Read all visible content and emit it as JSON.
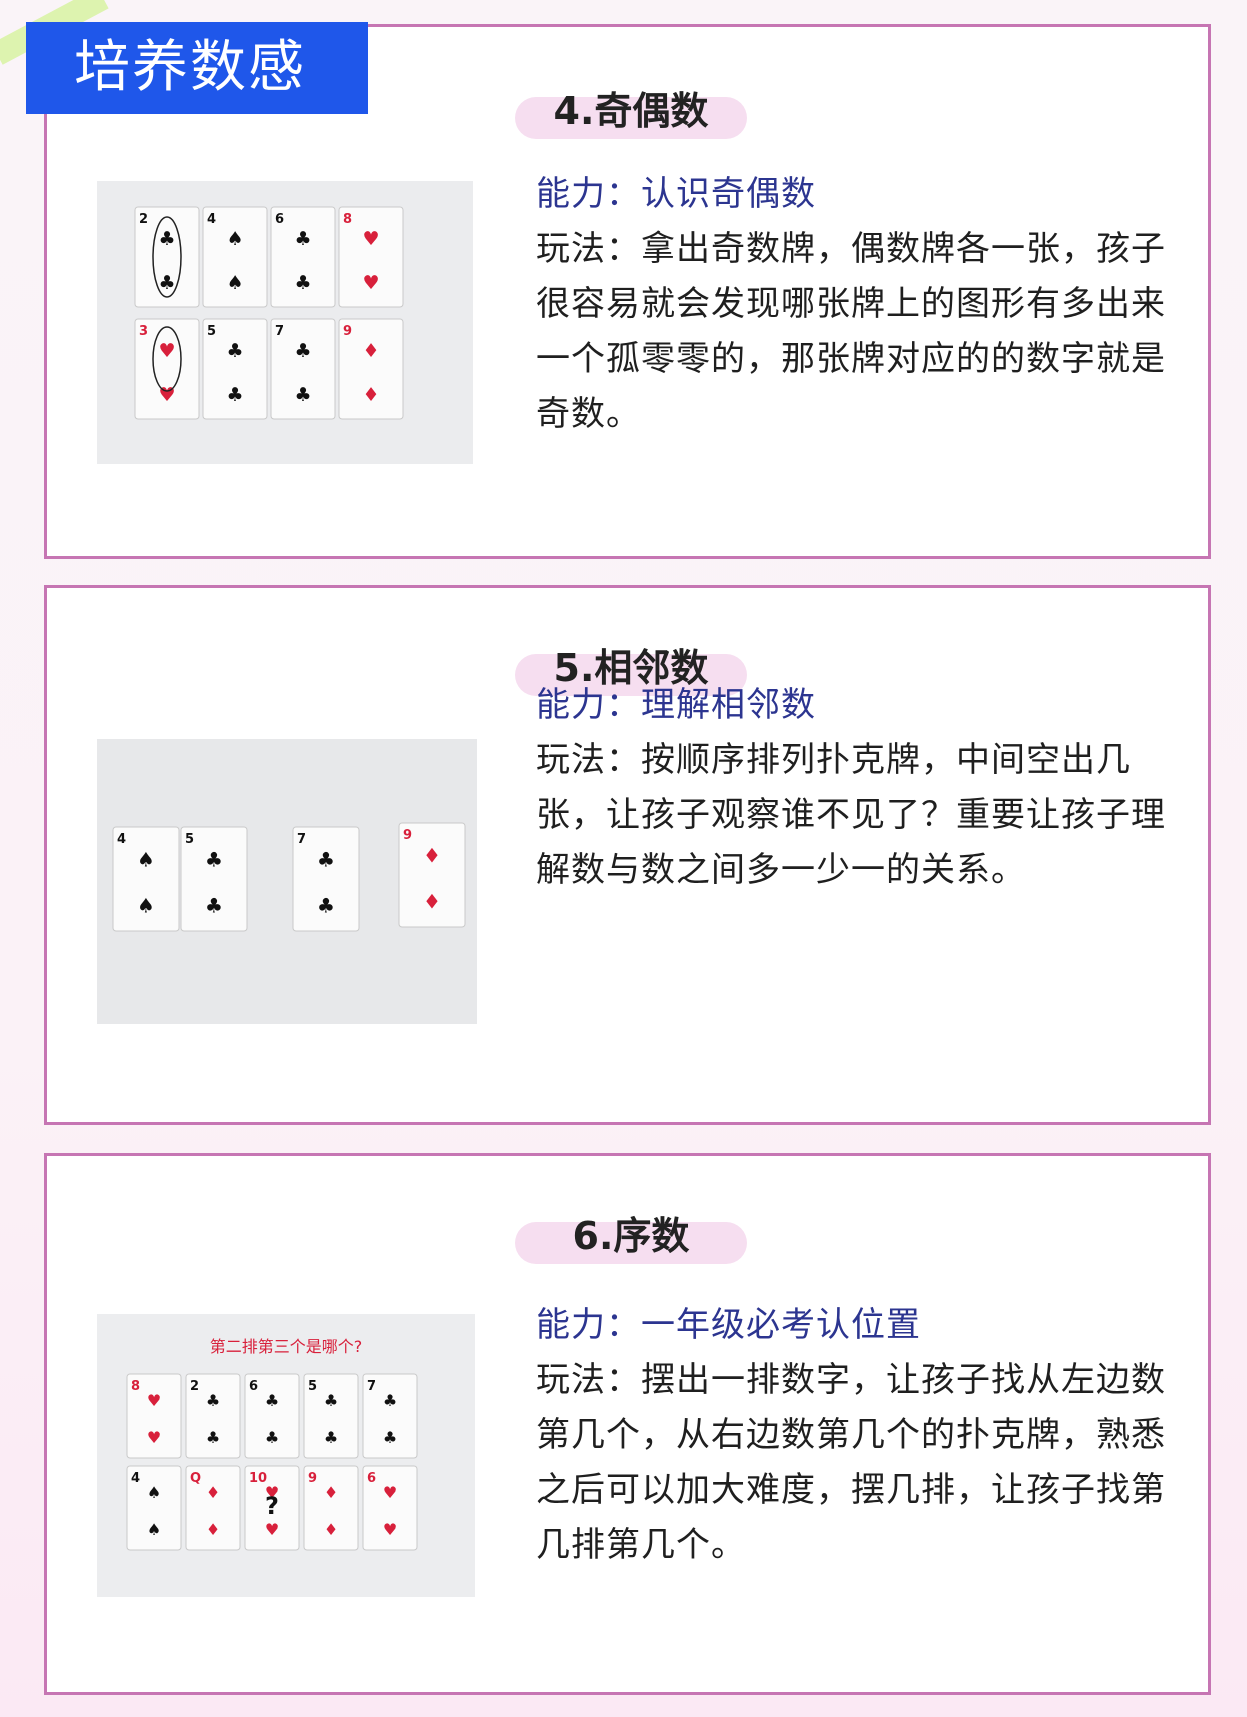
{
  "header": {
    "title": "培养数感"
  },
  "sections": [
    {
      "title": "4.奇偶数",
      "ability": "能力：认识奇偶数",
      "method": "玩法：拿出奇数牌，偶数牌各一张，孩子很容易就会发现哪张牌上的图形有多出来一个孤零零的，那张牌对应的的数字就是奇数。",
      "photo": {
        "rows": [
          [
            {
              "rank": "2",
              "suit": "♣",
              "color": "#111"
            },
            {
              "rank": "4",
              "suit": "♠",
              "color": "#111"
            },
            {
              "rank": "6",
              "suit": "♣",
              "color": "#111"
            },
            {
              "rank": "8",
              "suit": "♥",
              "color": "#d8203b"
            }
          ],
          [
            {
              "rank": "3",
              "suit": "♥",
              "color": "#d8203b"
            },
            {
              "rank": "5",
              "suit": "♣",
              "color": "#111"
            },
            {
              "rank": "7",
              "suit": "♣",
              "color": "#111"
            },
            {
              "rank": "9",
              "suit": "♦",
              "color": "#d8203b"
            }
          ]
        ]
      }
    },
    {
      "title": "5.相邻数",
      "ability": "能力：理解相邻数",
      "method": "玩法：按顺序排列扑克牌，中间空出几张，让孩子观察谁不见了？重要让孩子理解数与数之间多一少一的关系。",
      "photo": {
        "cards": [
          {
            "rank": "4",
            "suit": "♠",
            "color": "#111"
          },
          {
            "rank": "5",
            "suit": "♣",
            "color": "#111"
          },
          {
            "rank": "7",
            "suit": "♣",
            "color": "#111"
          },
          {
            "rank": "9",
            "suit": "♦",
            "color": "#d8203b"
          }
        ]
      }
    },
    {
      "title": "6.序数",
      "ability": "能力：一年级必考认位置",
      "method": "玩法：摆出一排数字，让孩子找从左边数第几个，从右边数第几个的扑克牌，熟悉之后可以加大难度，摆几排，让孩子找第几排第几个。",
      "photo": {
        "caption": "第二排第三个是哪个?",
        "mystery": "?",
        "rows": [
          [
            {
              "rank": "8",
              "suit": "♥",
              "color": "#d8203b"
            },
            {
              "rank": "2",
              "suit": "♣",
              "color": "#111"
            },
            {
              "rank": "6",
              "suit": "♣",
              "color": "#111"
            },
            {
              "rank": "5",
              "suit": "♣",
              "color": "#111"
            },
            {
              "rank": "7",
              "suit": "♣",
              "color": "#111"
            }
          ],
          [
            {
              "rank": "4",
              "suit": "♠",
              "color": "#111"
            },
            {
              "rank": "Q",
              "suit": "♦",
              "color": "#d8203b"
            },
            {
              "rank": "10",
              "suit": "♥",
              "color": "#d8203b"
            },
            {
              "rank": "9",
              "suit": "♦",
              "color": "#d8203b"
            },
            {
              "rank": "6",
              "suit": "♥",
              "color": "#d8203b"
            }
          ]
        ]
      }
    }
  ]
}
